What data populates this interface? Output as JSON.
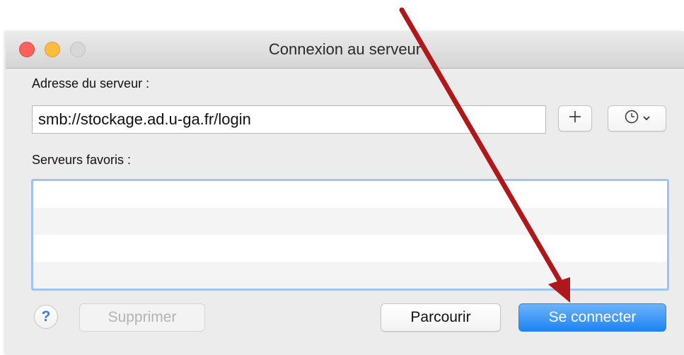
{
  "window": {
    "title": "Connexion au serveur"
  },
  "server_address": {
    "label": "Adresse du serveur :",
    "value": "smb://stockage.ad.u-ga.fr/login"
  },
  "favorites": {
    "label": "Serveurs favoris :",
    "items": []
  },
  "buttons": {
    "add": "+",
    "help": "?",
    "delete": "Supprimer",
    "browse": "Parcourir",
    "connect": "Se connecter"
  },
  "icons": {
    "add": "plus-icon",
    "recent": "clock-icon",
    "dropdown": "chevron-down-icon",
    "help": "question-icon",
    "annotation": "arrow-icon"
  },
  "colors": {
    "accent": "#1d84f3",
    "close": "#fc615d",
    "minimize": "#fdbc40",
    "annotation_arrow": "#b0171b",
    "focus_ring": "#9ec3ef"
  },
  "states": {
    "delete_enabled": false,
    "connect_default": true
  }
}
